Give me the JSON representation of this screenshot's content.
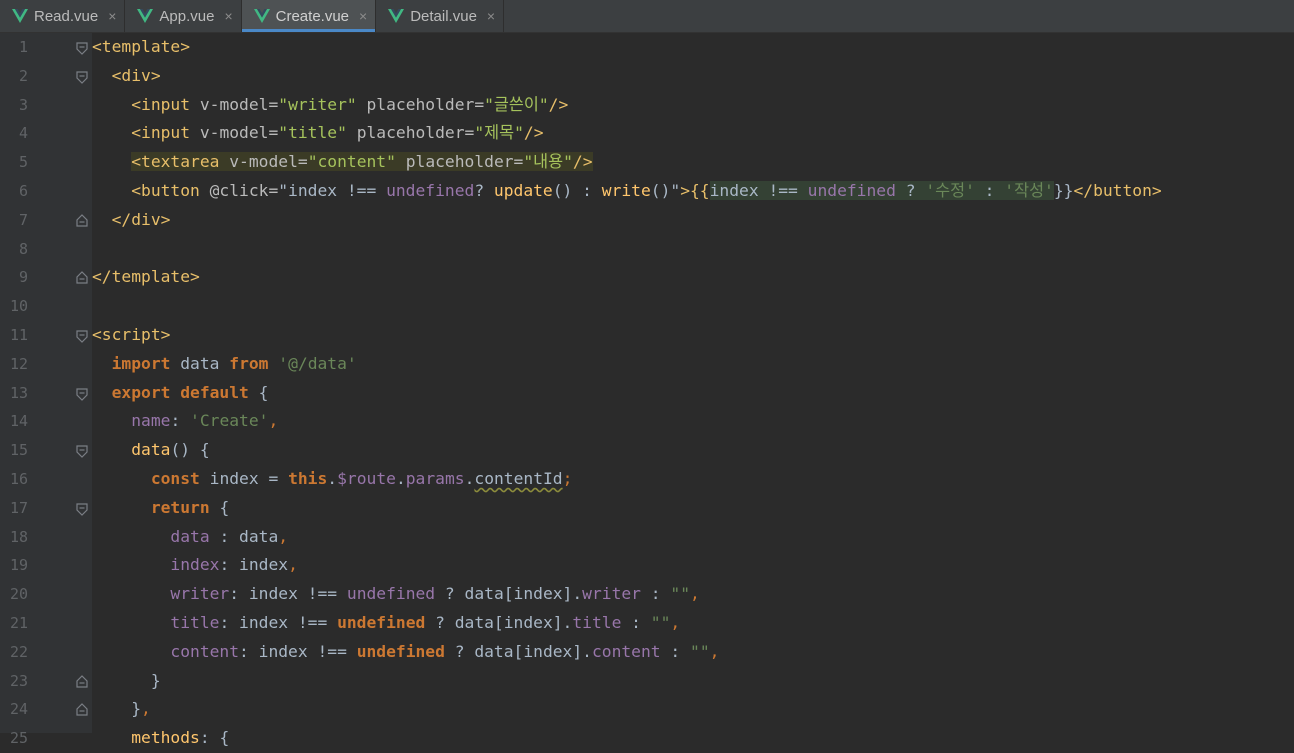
{
  "tabs": [
    {
      "label": "Read.vue",
      "active": false,
      "icon": "vue-icon"
    },
    {
      "label": "App.vue",
      "active": false,
      "icon": "vue-icon"
    },
    {
      "label": "Create.vue",
      "active": true,
      "icon": "vue-icon"
    },
    {
      "label": "Detail.vue",
      "active": false,
      "icon": "vue-icon"
    }
  ],
  "close_glyph": "×",
  "line_numbers": [
    "1",
    "2",
    "3",
    "4",
    "5",
    "6",
    "7",
    "8",
    "9",
    "10",
    "11",
    "12",
    "13",
    "14",
    "15",
    "16",
    "17",
    "18",
    "19",
    "20",
    "21",
    "22",
    "23",
    "24",
    "25"
  ],
  "code": {
    "l1": {
      "a": "<template>"
    },
    "l2": {
      "a": "  <div>"
    },
    "l3": {
      "a": "    <input",
      "b": " v-model=",
      "c": "\"writer\"",
      "d": " placeholder=",
      "e": "\"글쓴이\"",
      "f": "/>"
    },
    "l4": {
      "a": "    <input",
      "b": " v-model=",
      "c": "\"title\"",
      "d": " placeholder=",
      "e": "\"제목\"",
      "f": "/>"
    },
    "l5": {
      "a": "<textarea",
      "b": " v-model=",
      "c": "\"content\"",
      "d": " placeholder=",
      "e": "\"내용\"",
      "f": "/>",
      "indent": "    "
    },
    "l6": {
      "a": "    <button",
      "b": " @click=",
      "c": "\"index !== ",
      "d": "undefined",
      "e": "? ",
      "f": "update",
      "g": "() : ",
      "h": "write",
      "i": "()\"",
      "j": ">{{",
      "k": "index !== ",
      "l": "undefined",
      "m": " ? ",
      "n": "'수정'",
      "o": " : ",
      "p": "'작성'",
      "q": "}}",
      "r": "</button>"
    },
    "l7": {
      "a": "  </div>"
    },
    "l9": {
      "a": "</template>"
    },
    "l11": {
      "a": "<script>"
    },
    "l12": {
      "a": "  ",
      "b": "import",
      "c": " data ",
      "d": "from",
      "e": " ",
      "f": "'@/data'"
    },
    "l13": {
      "a": "  ",
      "b": "export default",
      "c": " {"
    },
    "l14": {
      "a": "    ",
      "b": "name",
      "c": ": ",
      "d": "'Create'",
      "e": ","
    },
    "l15": {
      "a": "    ",
      "b": "data",
      "c": "() {"
    },
    "l16": {
      "a": "      ",
      "b": "const",
      "c": " index = ",
      "d": "this",
      "e": ".",
      "f": "$route",
      "g": ".",
      "h": "params",
      "i": ".",
      "j": "contentId",
      "k": ";"
    },
    "l17": {
      "a": "      ",
      "b": "return",
      "c": " {"
    },
    "l18": {
      "a": "        ",
      "b": "data",
      "c": " : data",
      "d": ","
    },
    "l19": {
      "a": "        ",
      "b": "index",
      "c": ": index",
      "d": ","
    },
    "l20": {
      "a": "        ",
      "b": "writer",
      "c": ": index !== ",
      "d": "undefined",
      "e": " ? data[index].",
      "f": "writer",
      "g": " : ",
      "h": "\"\"",
      "i": ","
    },
    "l21": {
      "a": "        ",
      "b": "title",
      "c": ": index !== ",
      "d": "undefined",
      "e": " ? data[index].",
      "f": "title",
      "g": " : ",
      "h": "\"\"",
      "i": ","
    },
    "l22": {
      "a": "        ",
      "b": "content",
      "c": ": index !== ",
      "d": "undefined",
      "e": " ? data[index].",
      "f": "content",
      "g": " : ",
      "h": "\"\"",
      "i": ","
    },
    "l23": {
      "a": "      }"
    },
    "l24": {
      "a": "    }",
      "b": ","
    },
    "l25": {
      "a": "    ",
      "b": "methods",
      "c": ": {"
    }
  }
}
